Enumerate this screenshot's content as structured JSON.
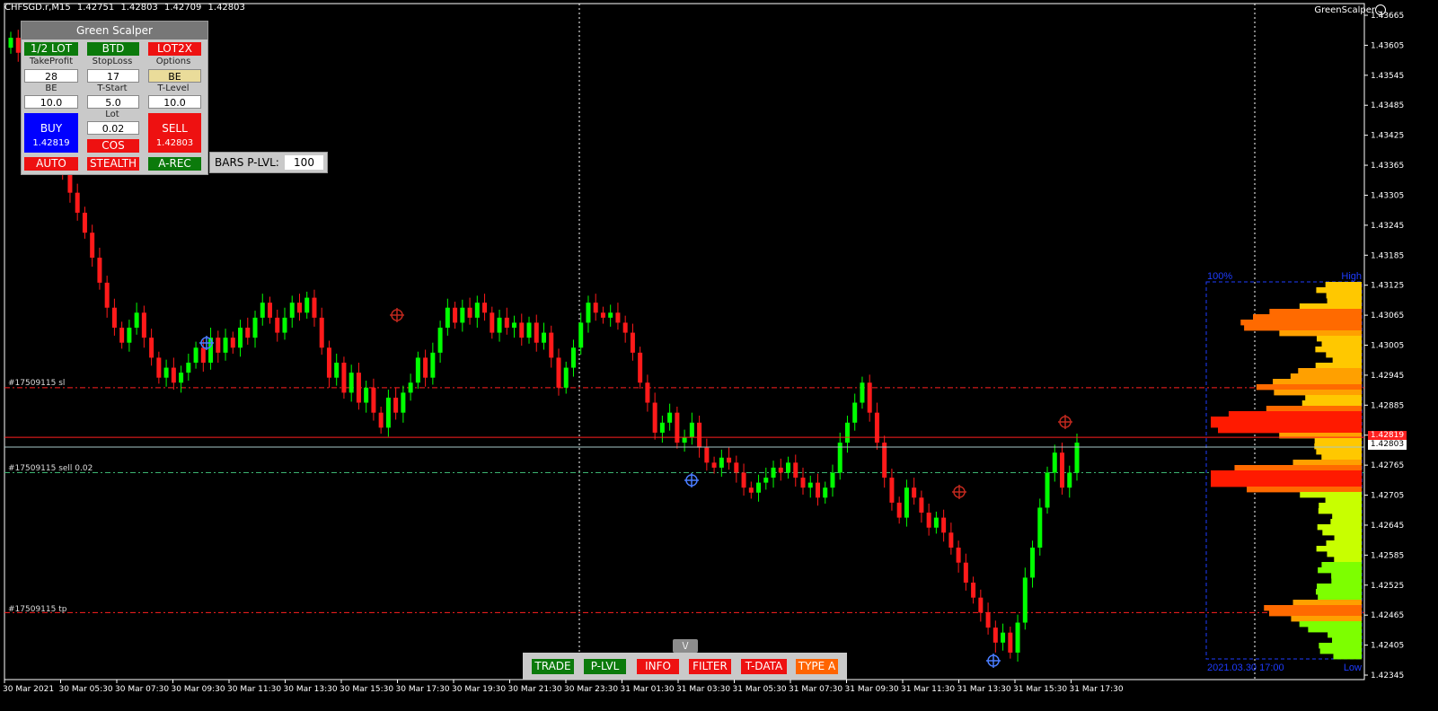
{
  "header": {
    "symbol": "CHFSGD.r,M15",
    "o": "1.42751",
    "h": "1.42803",
    "l": "1.42709",
    "c": "1.42803"
  },
  "ea_name": "GreenScalper",
  "panel": {
    "title": "Green Scalper",
    "half_lot": "1/2 LOT",
    "btd": "BTD",
    "lot2x": "LOT2X",
    "tp_label": "TakeProfit",
    "sl_label": "StopLoss",
    "options_label": "Options",
    "tp_value": "28",
    "sl_value": "17",
    "options_value": "BE",
    "be_label": "BE",
    "tstart_label": "T-Start",
    "tlevel_label": "T-Level",
    "be_value": "10.0",
    "tstart_value": "5.0",
    "tlevel_value": "10.0",
    "buy_label": "BUY",
    "buy_price": "1.42819",
    "sell_label": "SELL",
    "sell_price": "1.42803",
    "lot_label": "Lot",
    "lot_value": "0.02",
    "cos": "COS",
    "auto": "AUTO",
    "stealth": "STEALTH",
    "arec": "A-REC"
  },
  "bars_plvl": {
    "label": "BARS P-LVL:",
    "value": "100"
  },
  "toolbar": {
    "toggle": "\\/",
    "trade": "TRADE",
    "plvl": "P-LVL",
    "info": "INFO",
    "filter": "FILTER",
    "tdata": "T-DATA",
    "typea": "TYPE A"
  },
  "orders": {
    "sl": "#17509115 sl",
    "sell": "#17509115 sell 0.02",
    "tp": "#17509115 tp"
  },
  "profile_labels": {
    "pct": "100%",
    "high": "High",
    "low": "Low",
    "date": "2021.03.30 17:00"
  },
  "colors": {
    "bull": "#00ff00",
    "bear": "#ff1a1a",
    "grid": "#ffffff",
    "bid": "#a6c7c7",
    "ask": "#ff2020"
  },
  "chart_data": {
    "type": "candlestick",
    "yticks": [
      "1.43665",
      "1.43605",
      "1.43545",
      "1.43485",
      "1.43425",
      "1.43365",
      "1.43305",
      "1.43245",
      "1.43185",
      "1.43125",
      "1.43065",
      "1.43005",
      "1.42945",
      "1.42885",
      "1.42825",
      "1.42765",
      "1.42705",
      "1.42645",
      "1.42585",
      "1.42525",
      "1.42465",
      "1.42405",
      "1.42345"
    ],
    "ylim": [
      1.42345,
      1.43665
    ],
    "xticks": [
      "30 Mar 2021",
      "30 Mar 05:30",
      "30 Mar 07:30",
      "30 Mar 09:30",
      "30 Mar 11:30",
      "30 Mar 13:30",
      "30 Mar 15:30",
      "30 Mar 17:30",
      "30 Mar 19:30",
      "30 Mar 21:30",
      "30 Mar 23:30",
      "31 Mar 01:30",
      "31 Mar 03:30",
      "31 Mar 05:30",
      "31 Mar 07:30",
      "31 Mar 09:30",
      "31 Mar 11:30",
      "31 Mar 13:30",
      "31 Mar 15:30",
      "31 Mar 17:30"
    ],
    "bid_price": "1.42803",
    "ask_price": "1.42819",
    "levels": {
      "sl": 1.4292,
      "sell": 1.4275,
      "tp": 1.4247
    },
    "closes": [
      1.4362,
      1.4359,
      1.4355,
      1.4351,
      1.4347,
      1.4343,
      1.4339,
      1.4335,
      1.4331,
      1.4327,
      1.4323,
      1.4318,
      1.4313,
      1.4308,
      1.4304,
      1.4301,
      1.4304,
      1.4307,
      1.4302,
      1.4298,
      1.4294,
      1.4296,
      1.4293,
      1.4295,
      1.4297,
      1.43,
      1.4297,
      1.4302,
      1.4299,
      1.4302,
      1.43,
      1.4304,
      1.4302,
      1.4306,
      1.4309,
      1.4306,
      1.4303,
      1.4306,
      1.4309,
      1.4307,
      1.431,
      1.4306,
      1.43,
      1.4294,
      1.4297,
      1.4291,
      1.4295,
      1.4289,
      1.4292,
      1.4287,
      1.4284,
      1.429,
      1.4287,
      1.4291,
      1.4293,
      1.4298,
      1.4294,
      1.4299,
      1.4304,
      1.4308,
      1.4305,
      1.4308,
      1.4306,
      1.4309,
      1.4307,
      1.4303,
      1.4306,
      1.4304,
      1.4305,
      1.4302,
      1.4305,
      1.4301,
      1.4303,
      1.4298,
      1.4292,
      1.4296,
      1.43,
      1.4305,
      1.4309,
      1.4307,
      1.4306,
      1.4307,
      1.4305,
      1.4303,
      1.4299,
      1.4293,
      1.4289,
      1.4283,
      1.4285,
      1.4287,
      1.4281,
      1.4282,
      1.4285,
      1.428,
      1.4277,
      1.4276,
      1.4278,
      1.4277,
      1.4275,
      1.4272,
      1.4271,
      1.4273,
      1.4274,
      1.4276,
      1.4275,
      1.4277,
      1.4274,
      1.4272,
      1.4273,
      1.427,
      1.4272,
      1.4275,
      1.4281,
      1.4285,
      1.4289,
      1.4293,
      1.4287,
      1.4281,
      1.4274,
      1.4269,
      1.4266,
      1.4272,
      1.427,
      1.4267,
      1.4264,
      1.4266,
      1.4263,
      1.426,
      1.4257,
      1.4253,
      1.425,
      1.4247,
      1.4244,
      1.4241,
      1.4243,
      1.4239,
      1.4245,
      1.4254,
      1.426,
      1.4268,
      1.4275,
      1.4279,
      1.4272,
      1.4275,
      1.4281
    ]
  }
}
